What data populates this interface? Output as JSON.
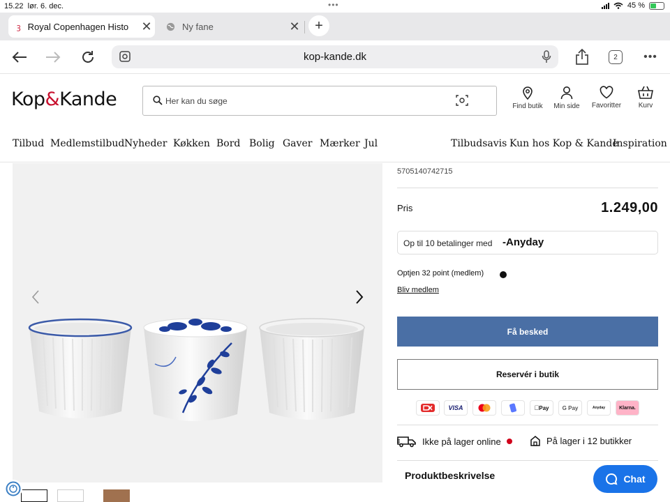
{
  "status": {
    "time": "15.22",
    "date": "lør. 6. dec.",
    "battery": "45 %",
    "battery_level": 0.45
  },
  "tabs": [
    {
      "title": "Royal Copenhagen Histo",
      "active": true
    },
    {
      "title": "Ny fane",
      "active": false
    }
  ],
  "toolbar": {
    "url": "kop-kande.dk",
    "tab_count": "2"
  },
  "header": {
    "logo_left": "Kop",
    "logo_amp": "&",
    "logo_right": "Kande",
    "search_placeholder": "Her kan du søge",
    "icons": [
      {
        "label": "Find butik",
        "icon": "location-pin-icon"
      },
      {
        "label": "Min side",
        "icon": "user-icon"
      },
      {
        "label": "Favoritter",
        "icon": "heart-icon"
      },
      {
        "label": "Kurv",
        "icon": "basket-icon"
      }
    ]
  },
  "nav": {
    "left": [
      "Tilbud",
      "Medlemstilbud",
      "Nyheder",
      "Køkken",
      "Bord",
      "Bolig",
      "Gaver",
      "Mærker",
      "Jul"
    ],
    "right": [
      "Tilbudsavis",
      "Kun hos Kop & Kande",
      "Inspiration"
    ]
  },
  "product": {
    "ean": "5705140742715",
    "price_label": "Pris",
    "price": "1.249,00",
    "anyday_text": "Op til 10 betalinger med",
    "anyday_brand": "Anyday",
    "points": "Optjen 32 point (medlem)",
    "member_link": "Bliv medlem",
    "notify_button": "Få besked",
    "reserve_button": "Reservér i butik",
    "payments": [
      "Dankort",
      "VISA",
      "Mastercard",
      "MobilePay",
      "Apple Pay",
      "G Pay",
      "Anyday",
      "Klarna."
    ],
    "stock_online": "Ikke på lager online",
    "stock_store": "På lager i 12 butikker",
    "description_heading": "Produktbeskrivelse"
  },
  "chat": {
    "label": "Chat"
  },
  "colors": {
    "primary_button": "#4a6fa5",
    "logo_accent": "#c8102e",
    "chat": "#1a73e8",
    "out_of_stock": "#d0021b"
  }
}
